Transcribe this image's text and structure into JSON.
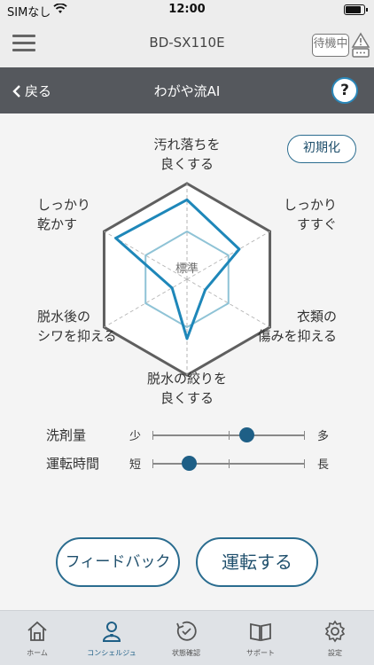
{
  "status_bar": {
    "carrier": "SIMなし",
    "time": "12:00",
    "battery_level": 0.9
  },
  "app_bar": {
    "model": "BD-SX110E",
    "standby": "待機中"
  },
  "nav": {
    "back_label": "戻る",
    "title": "わがや流AI",
    "help_label": "?"
  },
  "radar": {
    "center_label": "標準",
    "reset_label": "初期化",
    "axes": [
      {
        "line1": "汚れ落ちを",
        "line2": "良くする",
        "value": 0.83
      },
      {
        "line1": "しっかり",
        "line2": "すすぐ",
        "value": 0.63
      },
      {
        "line1": "衣類の",
        "line2": "傷みを抑える",
        "value": 0.22
      },
      {
        "line1": "脱水の絞りを",
        "line2": "良くする",
        "value": 0.62
      },
      {
        "line1": "脱水後の",
        "line2": "シワを抑える",
        "value": 0.18
      },
      {
        "line1": "しっかり",
        "line2": "乾かす",
        "value": 0.86
      }
    ]
  },
  "sliders": [
    {
      "name": "洗剤量",
      "min_label": "少",
      "max_label": "多",
      "value": 0.62
    },
    {
      "name": "運転時間",
      "min_label": "短",
      "max_label": "長",
      "value": 0.24
    }
  ],
  "buttons": {
    "feedback": "フィードバック",
    "run": "運転する"
  },
  "tabs": [
    {
      "label": "ホーム",
      "icon": "home-icon",
      "active": false
    },
    {
      "label": "コンシェルジュ",
      "icon": "concierge-icon",
      "active": true
    },
    {
      "label": "状態確認",
      "icon": "status-icon",
      "active": false
    },
    {
      "label": "サポート",
      "icon": "book-icon",
      "active": false
    },
    {
      "label": "設定",
      "icon": "gear-icon",
      "active": false
    }
  ],
  "colors": {
    "accent": "#1e87b9",
    "navbar": "#55585d",
    "button_border": "#2a6c8f",
    "inner_hex": "#8fc3d6"
  }
}
